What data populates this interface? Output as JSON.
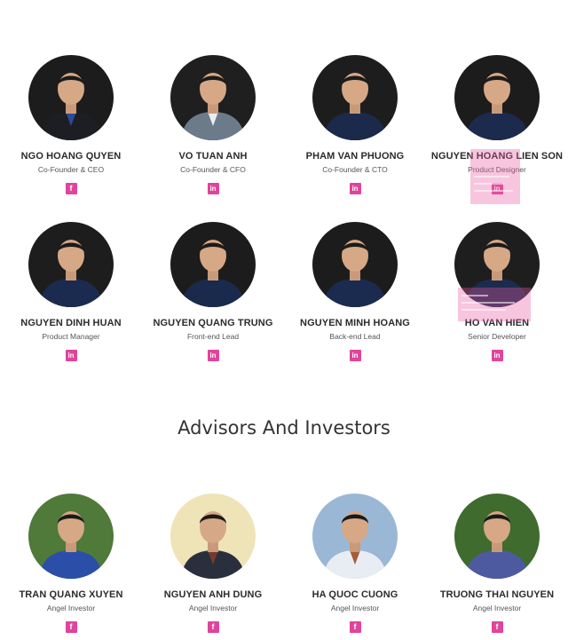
{
  "team_row_1": [
    {
      "name": "NGO HOANG QUYEN",
      "role": "Co-Founder & CEO",
      "social": "facebook-icon",
      "bg": "#1c1c1c",
      "shirt": "#1d1d24",
      "accent": "#2c4a9a"
    },
    {
      "name": "VO TUAN ANH",
      "role": "Co-Founder & CFO",
      "social": "linkedin-icon",
      "bg": "#1f1f1f",
      "shirt": "#6c7b8a",
      "accent": "#e9eef2"
    },
    {
      "name": "PHAM VAN PHUONG",
      "role": "Co-Founder & CTO",
      "social": "linkedin-icon",
      "bg": "#1d1d1d",
      "shirt": "#1b2a4a",
      "accent": "#1b2a4a"
    },
    {
      "name": "NGUYEN HOANG LIEN SON",
      "role": "Product Designer",
      "social": "linkedin-icon",
      "bg": "#1c1c1c",
      "shirt": "#1c2b4d",
      "accent": "#1c2b4d"
    }
  ],
  "team_row_2": [
    {
      "name": "NGUYEN DINH HUAN",
      "role": "Product Manager",
      "social": "linkedin-icon",
      "bg": "#1d1d1d",
      "shirt": "#1b2b50",
      "accent": "#1b2b50"
    },
    {
      "name": "NGUYEN QUANG TRUNG",
      "role": "Front-end Lead",
      "social": "linkedin-icon",
      "bg": "#1c1c1c",
      "shirt": "#1a2a4d",
      "accent": "#1a2a4d"
    },
    {
      "name": "NGUYEN MINH HOANG",
      "role": "Back-end Lead",
      "social": "linkedin-icon",
      "bg": "#1c1c1c",
      "shirt": "#1b2b4f",
      "accent": "#1b2b4f"
    },
    {
      "name": "HO VAN HIEN",
      "role": "Senior Developer",
      "social": "linkedin-icon",
      "bg": "#1e1e1e",
      "shirt": "#1c2c4e",
      "accent": "#1c2c4e"
    }
  ],
  "section": {
    "title": "Advisors And Investors"
  },
  "advisors": [
    {
      "name": "TRAN QUANG XUYEN",
      "role": "Angel Investor",
      "social": "facebook-icon",
      "bg": "#4f7a3a",
      "shirt": "#2b4fa8",
      "accent": "#2b4fa8"
    },
    {
      "name": "NGUYEN ANH DUNG",
      "role": "Angel Investor",
      "social": "facebook-icon",
      "bg": "#efe3b8",
      "shirt": "#2a2f3d",
      "accent": "#7a3a2a"
    },
    {
      "name": "HA QUOC CUONG",
      "role": "Angel Investor",
      "social": "facebook-icon",
      "bg": "#9bb7d6",
      "shirt": "#e8edf3",
      "accent": "#a85a3a"
    },
    {
      "name": "TRUONG THAI NGUYEN",
      "role": "Angel Investor",
      "social": "facebook-icon",
      "bg": "#3f6b2e",
      "shirt": "#4e5aa0",
      "accent": "#4e5aa0"
    }
  ],
  "colors": {
    "social_icon": "#e0449b",
    "heading": "#333333"
  }
}
